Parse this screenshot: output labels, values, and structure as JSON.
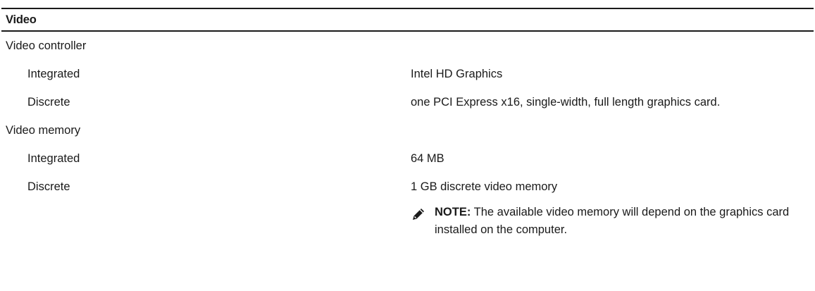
{
  "section": {
    "title": "Video"
  },
  "rows": {
    "controller": {
      "label": "Video controller",
      "integrated_label": "Integrated",
      "integrated_value": "Intel HD Graphics",
      "discrete_label": "Discrete",
      "discrete_value": "one PCI Express x16, single-width, full length graphics card."
    },
    "memory": {
      "label": "Video memory",
      "integrated_label": "Integrated",
      "integrated_value": "64 MB",
      "discrete_label": "Discrete",
      "discrete_value": "1 GB discrete video memory"
    }
  },
  "note": {
    "icon": "pencil-note-icon",
    "prefix": "NOTE:",
    "text": " The available video memory will depend on the graphics card installed on the computer."
  }
}
